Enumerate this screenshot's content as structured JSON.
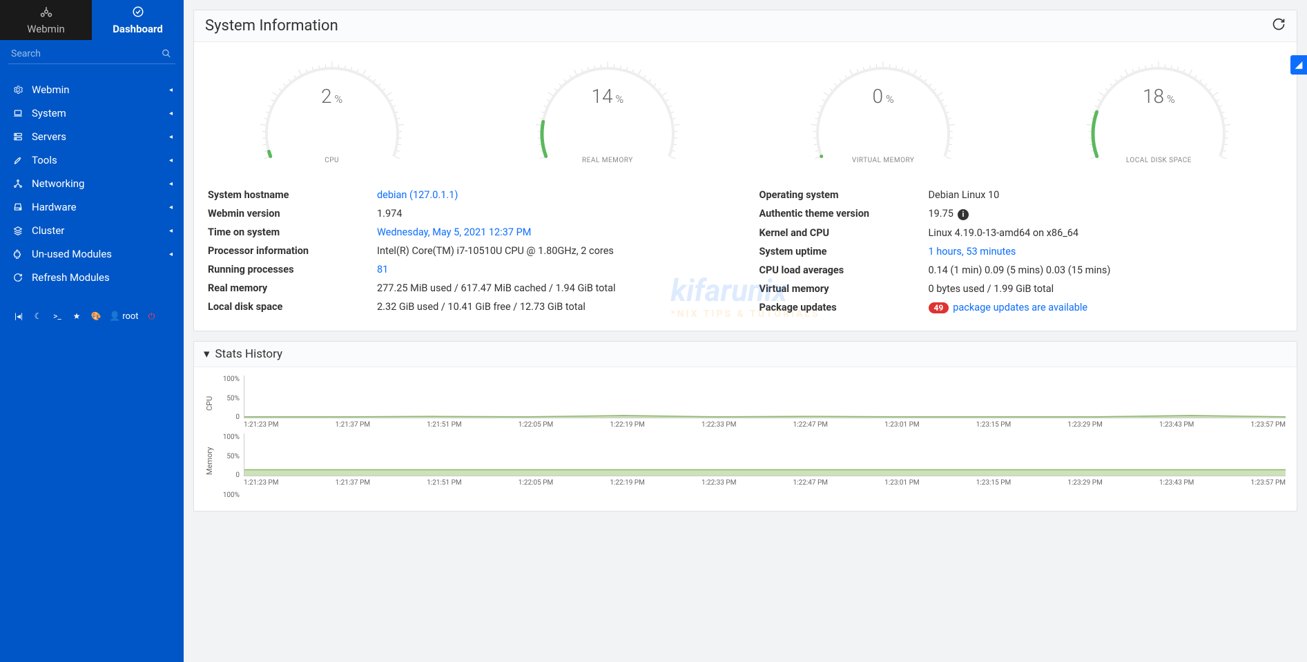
{
  "tabs": {
    "webmin": "Webmin",
    "dashboard": "Dashboard"
  },
  "search": {
    "placeholder": "Search"
  },
  "nav": [
    {
      "label": "Webmin",
      "icon": "gear"
    },
    {
      "label": "System",
      "icon": "laptop"
    },
    {
      "label": "Servers",
      "icon": "server"
    },
    {
      "label": "Tools",
      "icon": "tools"
    },
    {
      "label": "Networking",
      "icon": "network"
    },
    {
      "label": "Hardware",
      "icon": "hdd"
    },
    {
      "label": "Cluster",
      "icon": "layers"
    },
    {
      "label": "Un-used Modules",
      "icon": "puzzle"
    },
    {
      "label": "Refresh Modules",
      "icon": "refresh",
      "no_chev": true
    }
  ],
  "toolbar_user": "root",
  "panel_title": "System Information",
  "gauges": [
    {
      "value": 2,
      "label": "CPU"
    },
    {
      "value": 14,
      "label": "REAL MEMORY"
    },
    {
      "value": 0,
      "label": "VIRTUAL MEMORY"
    },
    {
      "value": 18,
      "label": "LOCAL DISK SPACE"
    }
  ],
  "info_left": [
    {
      "label": "System hostname",
      "value": "debian (127.0.1.1)",
      "link": true
    },
    {
      "label": "Webmin version",
      "value": "1.974"
    },
    {
      "label": "Time on system",
      "value": "Wednesday, May 5, 2021 12:37 PM",
      "link": true
    },
    {
      "label": "Processor information",
      "value": "Intel(R) Core(TM) i7-10510U CPU @ 1.80GHz, 2 cores"
    },
    {
      "label": "Running processes",
      "value": "81",
      "link": true
    },
    {
      "label": "Real memory",
      "value": "277.25 MiB used / 617.47 MiB cached / 1.94 GiB total"
    },
    {
      "label": "Local disk space",
      "value": "2.32 GiB used / 10.41 GiB free / 12.73 GiB total"
    }
  ],
  "info_right": [
    {
      "label": "Operating system",
      "value": "Debian Linux 10"
    },
    {
      "label": "Authentic theme version",
      "value": "19.75",
      "info_icon": true
    },
    {
      "label": "Kernel and CPU",
      "value": "Linux 4.19.0-13-amd64 on x86_64"
    },
    {
      "label": "System uptime",
      "value": "1 hours, 53 minutes",
      "link": true
    },
    {
      "label": "CPU load averages",
      "value": "0.14 (1 min) 0.09 (5 mins) 0.03 (15 mins)"
    },
    {
      "label": "Virtual memory",
      "value": "0 bytes used / 1.99 GiB total"
    },
    {
      "label": "Package updates",
      "badge": "49",
      "value": "package updates are available",
      "link": true
    }
  ],
  "stats_title": "Stats History",
  "yticks": [
    "100%",
    "50%",
    "0"
  ],
  "xticks": [
    "1:21:23 PM",
    "1:21:37 PM",
    "1:21:51 PM",
    "1:22:05 PM",
    "1:22:19 PM",
    "1:22:33 PM",
    "1:22:47 PM",
    "1:23:01 PM",
    "1:23:15 PM",
    "1:23:29 PM",
    "1:23:43 PM",
    "1:23:57 PM"
  ],
  "charts": [
    {
      "name": "CPU",
      "fill_pct": 2
    },
    {
      "name": "Memory",
      "fill_pct": 14
    }
  ],
  "third_chart_yticks": [
    "100%"
  ],
  "chart_data": [
    {
      "type": "line",
      "title": "CPU",
      "ylabel": "CPU",
      "ylim": [
        0,
        100
      ],
      "categories": [
        "1:21:23 PM",
        "1:21:37 PM",
        "1:21:51 PM",
        "1:22:05 PM",
        "1:22:19 PM",
        "1:22:33 PM",
        "1:22:47 PM",
        "1:23:01 PM",
        "1:23:15 PM",
        "1:23:29 PM",
        "1:23:43 PM",
        "1:23:57 PM"
      ],
      "values": [
        2,
        2,
        3,
        2,
        5,
        2,
        3,
        2,
        2,
        2,
        5,
        2
      ]
    },
    {
      "type": "line",
      "title": "Memory",
      "ylabel": "Memory",
      "ylim": [
        0,
        100
      ],
      "categories": [
        "1:21:23 PM",
        "1:21:37 PM",
        "1:21:51 PM",
        "1:22:05 PM",
        "1:22:19 PM",
        "1:22:33 PM",
        "1:22:47 PM",
        "1:23:01 PM",
        "1:23:15 PM",
        "1:23:29 PM",
        "1:23:43 PM",
        "1:23:57 PM"
      ],
      "values": [
        14,
        14,
        14,
        14,
        14,
        14,
        14,
        14,
        14,
        14,
        14,
        14
      ]
    }
  ],
  "watermark": {
    "brand": "kifarunix",
    "tagline": "*NIX TIPS & TUTORIALS"
  }
}
